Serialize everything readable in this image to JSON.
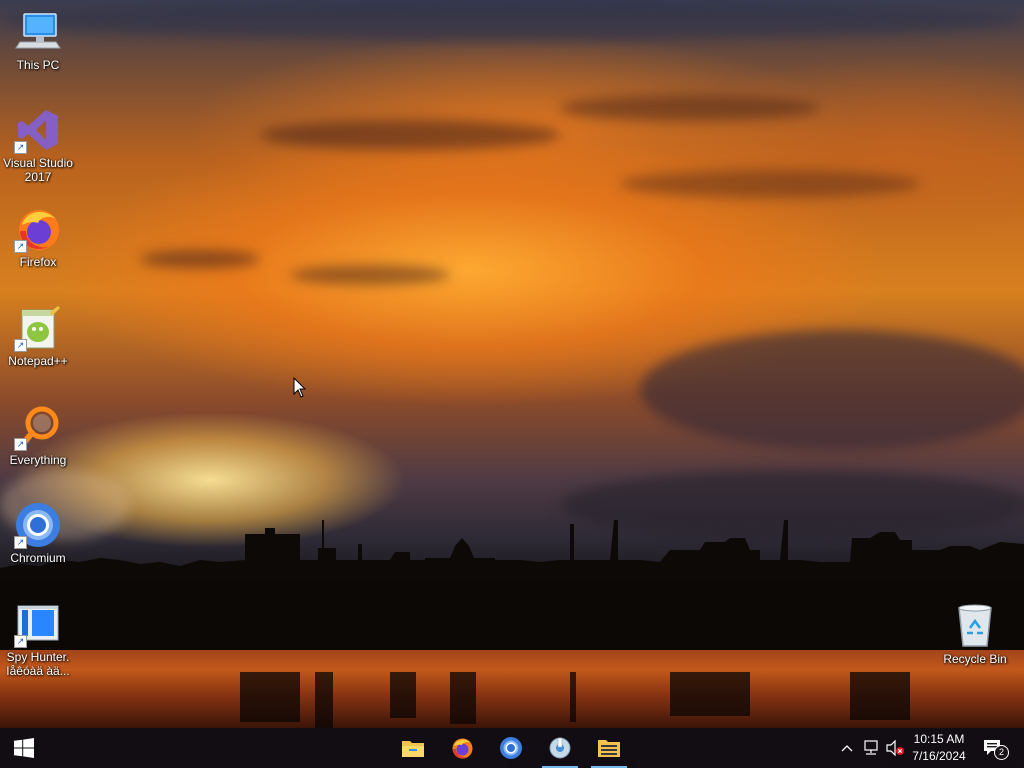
{
  "desktop": {
    "icons": [
      {
        "label": "This PC",
        "icon": "computer-icon"
      },
      {
        "label": "Visual Studio 2017",
        "icon": "visual-studio-icon"
      },
      {
        "label": "Firefox",
        "icon": "firefox-icon"
      },
      {
        "label": "Notepad++",
        "icon": "notepadpp-icon"
      },
      {
        "label": "Everything",
        "icon": "everything-search-icon"
      },
      {
        "label": "Chromium",
        "icon": "chromium-icon"
      },
      {
        "label": "Spy Hunter. Iåêóàä àä...",
        "icon": "spyhunter-icon"
      },
      {
        "label": "Recycle Bin",
        "icon": "recycle-bin-icon"
      }
    ]
  },
  "taskbar": {
    "start_icon": "windows-start-icon",
    "apps": [
      {
        "name": "File Explorer",
        "icon": "folder-icon"
      },
      {
        "name": "Firefox",
        "icon": "firefox-icon"
      },
      {
        "name": "Chromium",
        "icon": "chromium-icon"
      },
      {
        "name": "Installer",
        "icon": "installer-icon"
      },
      {
        "name": "Archive",
        "icon": "archive-icon"
      }
    ],
    "tray": {
      "time": "10:15 AM",
      "date": "7/16/2024",
      "notification_count": "2"
    }
  },
  "colors": {
    "taskbar_bg": "#120e14",
    "active_indicator": "#76b9ed",
    "sky_orange": "#d8801f"
  }
}
